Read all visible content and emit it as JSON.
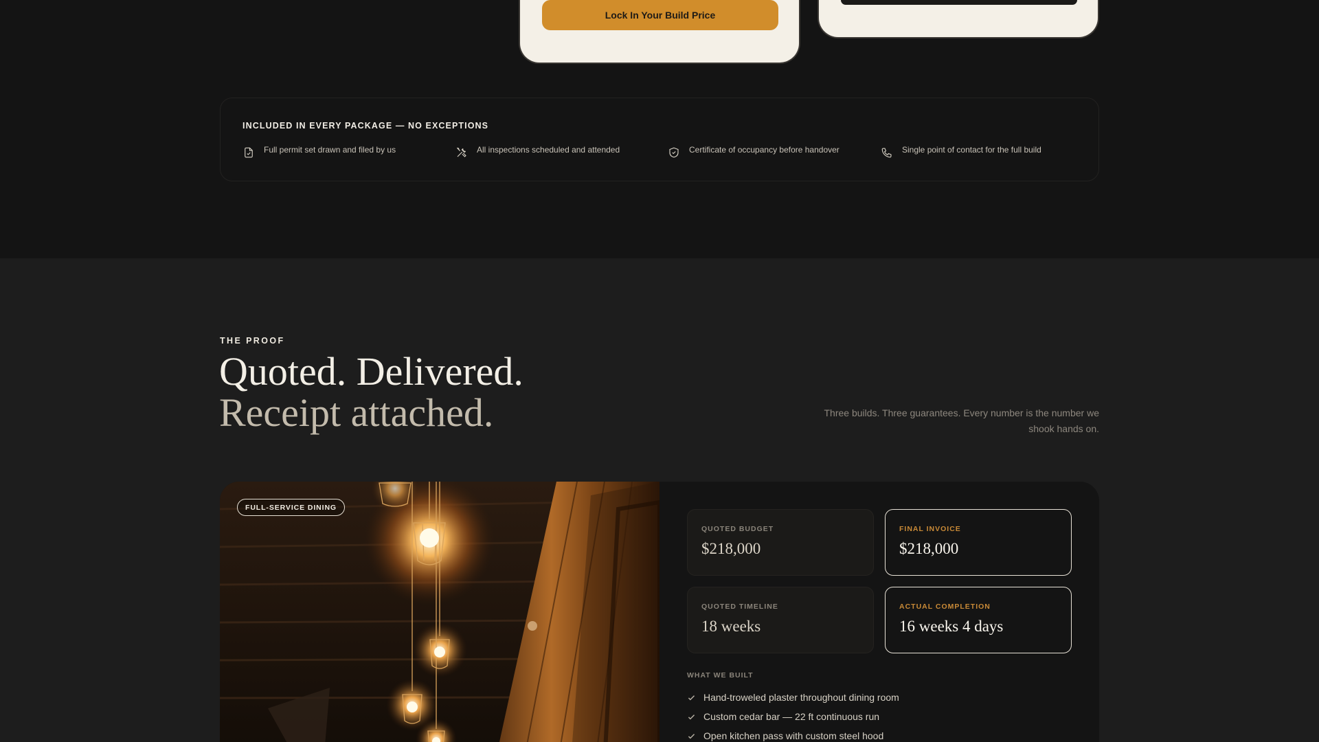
{
  "pricing": {
    "cta_label": "Lock In Your Build Price"
  },
  "included": {
    "title": "INCLUDED IN EVERY PACKAGE — NO EXCEPTIONS",
    "items": [
      {
        "icon": "document-check-icon",
        "label": "Full permit set drawn and filed by us"
      },
      {
        "icon": "tools-icon",
        "label": "All inspections scheduled and attended"
      },
      {
        "icon": "shield-check-icon",
        "label": "Certificate of occupancy before handover"
      },
      {
        "icon": "phone-icon",
        "label": "Single point of contact for the full build"
      }
    ]
  },
  "proof": {
    "eyebrow": "THE PROOF",
    "headline_line1": "Quoted. Delivered.",
    "headline_line2": "Receipt attached.",
    "intro": "Three builds. Three guarantees. Every number is the number we shook hands on.",
    "case": {
      "category": "FULL-SERVICE DINING",
      "stats": [
        {
          "label": "QUOTED BUDGET",
          "value": "$218,000"
        },
        {
          "label": "FINAL INVOICE",
          "value": "$218,000"
        },
        {
          "label": "QUOTED TIMELINE",
          "value": "18 weeks"
        },
        {
          "label": "ACTUAL COMPLETION",
          "value": "16 weeks 4 days"
        }
      ],
      "built_label": "WHAT WE BUILT",
      "built_items": [
        "Hand-troweled plaster throughout dining room",
        "Custom cedar bar — 22 ft continuous run",
        "Open kitchen pass with custom steel hood"
      ]
    }
  },
  "colors": {
    "accent": "#d18d2b",
    "background": "#141414",
    "section_background": "#1d1d1d",
    "card_cream": "#f4f0e7"
  }
}
